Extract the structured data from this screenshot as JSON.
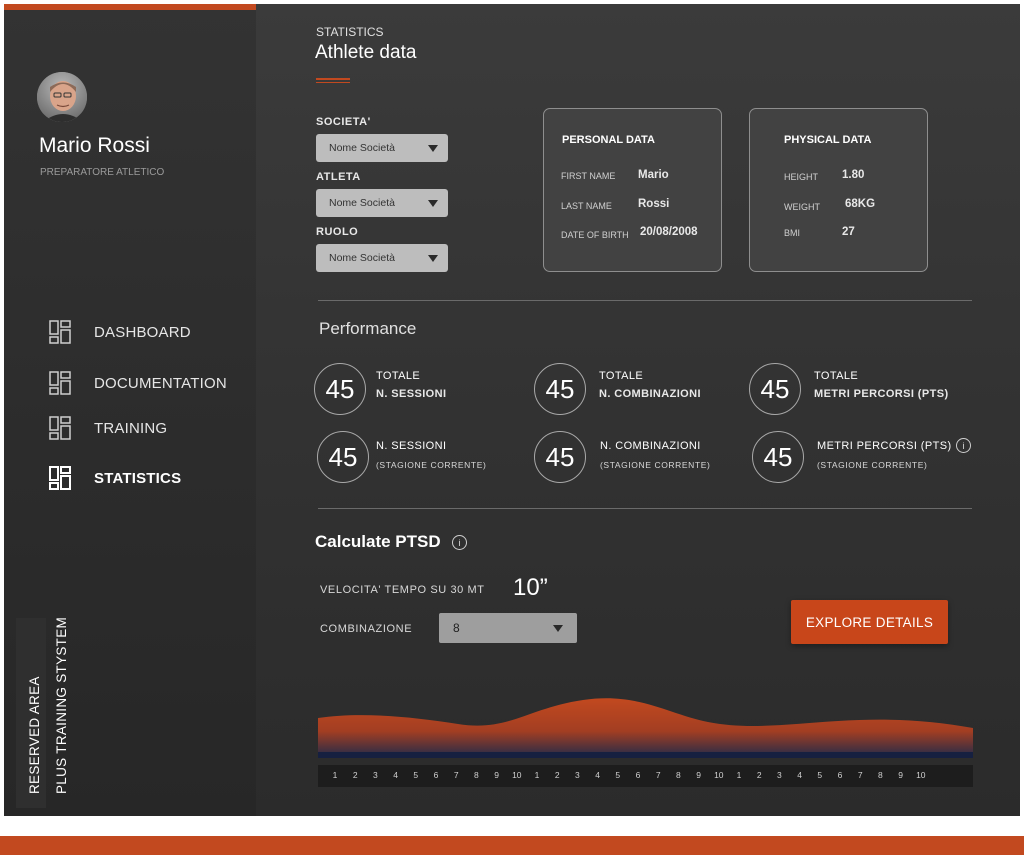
{
  "sidebar": {
    "profile": {
      "name": "Mario Rossi",
      "role": "PREPARATORE ATLETICO"
    },
    "nav": [
      {
        "label": "DASHBOARD",
        "icon": "dashboard-grid-icon",
        "active": false
      },
      {
        "label": "DOCUMENTATION",
        "icon": "documentation-grid-icon",
        "active": false
      },
      {
        "label": "TRAINING",
        "icon": "training-grid-icon",
        "active": false
      },
      {
        "label": "STATISTICS",
        "icon": "statistics-grid-icon",
        "active": true
      }
    ],
    "reserved_area": "RESERVED AREA",
    "system_name": "PLUS TRAINING STYSTEM"
  },
  "header": {
    "crumb": "STATISTICS",
    "title": "Athlete data"
  },
  "filters": [
    {
      "label": "SOCIETA'",
      "value": "Nome Società"
    },
    {
      "label": "ATLETA",
      "value": "Nome Società"
    },
    {
      "label": "RUOLO",
      "value": "Nome Società"
    }
  ],
  "personal_data": {
    "title": "PERSONAL DATA",
    "fields": [
      {
        "key": "FIRST NAME",
        "value": "Mario"
      },
      {
        "key": "LAST NAME",
        "value": "Rossi"
      },
      {
        "key": "DATE OF BIRTH",
        "value": "20/08/2008"
      }
    ]
  },
  "physical_data": {
    "title": "PHYSICAL DATA",
    "fields": [
      {
        "key": "HEIGHT",
        "value": "1.80"
      },
      {
        "key": "WEIGHT",
        "value": "68KG"
      },
      {
        "key": "BMI",
        "value": "27"
      }
    ]
  },
  "performance": {
    "title": "Performance",
    "stats": [
      {
        "value": "45",
        "line1": "TOTALE",
        "line2": "N. SESSIONI"
      },
      {
        "value": "45",
        "line1": "TOTALE",
        "line2": "N. COMBINAZIONI"
      },
      {
        "value": "45",
        "line1": "TOTALE",
        "line2": "METRI PERCORSI (PTS)"
      },
      {
        "value": "45",
        "line1": "N. SESSIONI",
        "sub": "(STAGIONE CORRENTE)"
      },
      {
        "value": "45",
        "line1": "N. COMBINAZIONI",
        "sub": "(STAGIONE CORRENTE)"
      },
      {
        "value": "45",
        "line1": "METRI PERCORSI (PTS)",
        "sub": "(STAGIONE CORRENTE)"
      }
    ]
  },
  "ptsd": {
    "title": "Calculate PTSD",
    "velocity_label": "VELOCITA' TEMPO SU 30 MT",
    "velocity_value": "10”",
    "combination_label": "COMBINAZIONE",
    "combination_value": "8",
    "explore_label": "EXPLORE DETAILS",
    "info_icon": "i"
  },
  "chart_data": {
    "type": "area",
    "x": [
      "1",
      "2",
      "3",
      "4",
      "5",
      "6",
      "7",
      "8",
      "9",
      "10",
      "1",
      "2",
      "3",
      "4",
      "5",
      "6",
      "7",
      "8",
      "9",
      "10",
      "1",
      "2",
      "3",
      "4",
      "5",
      "6",
      "7",
      "8",
      "9",
      "10"
    ],
    "colors": {
      "top": "#c2491f",
      "bottom": "#1f2a4a"
    }
  },
  "theme": {
    "accent": "#c2491f"
  }
}
